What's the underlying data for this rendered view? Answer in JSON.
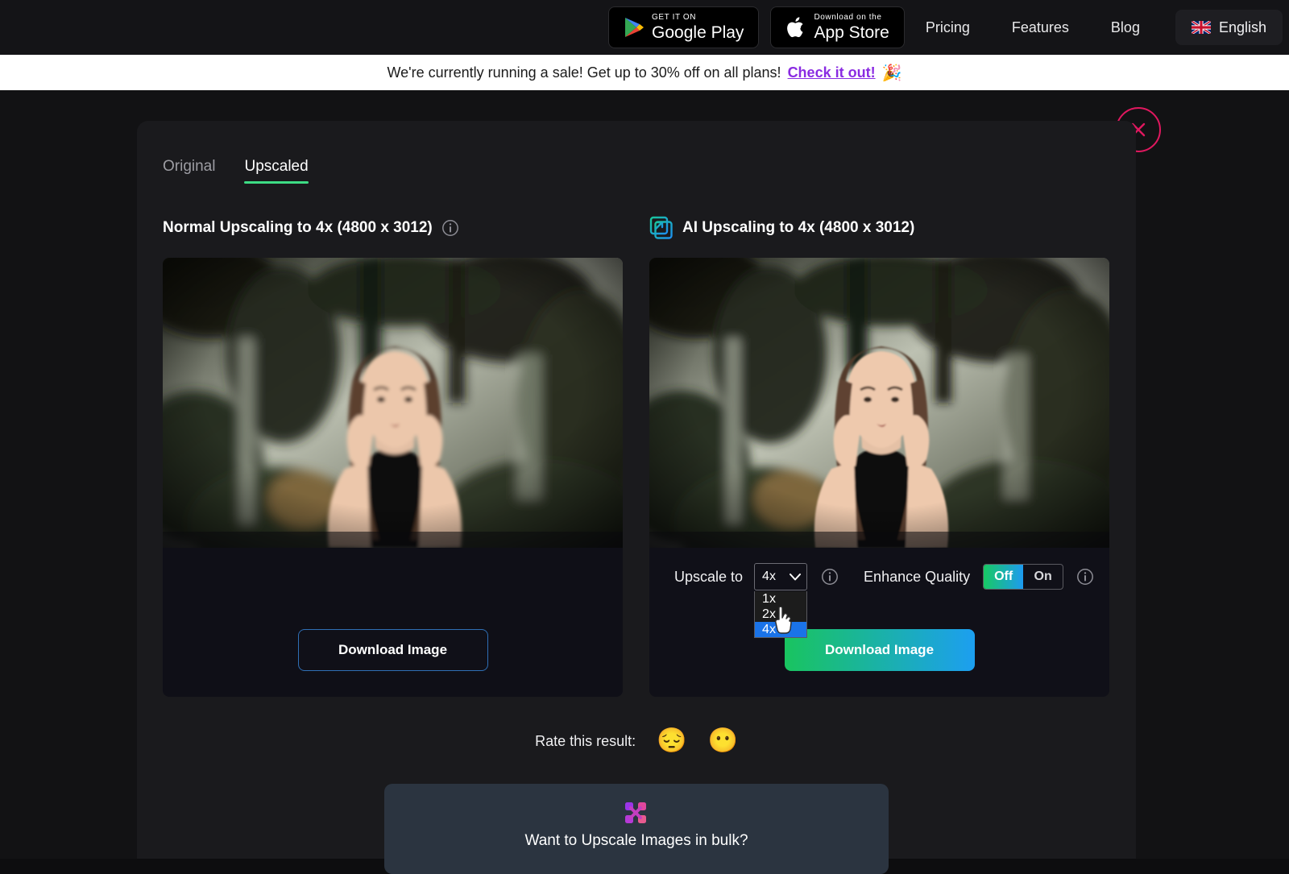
{
  "topnav": {
    "google_play": {
      "small": "GET IT ON",
      "big": "Google Play",
      "icon": "google-play-icon"
    },
    "app_store": {
      "small": "Download on the",
      "big": "App Store",
      "icon": "apple-icon"
    },
    "links": [
      {
        "label": "Pricing"
      },
      {
        "label": "Features"
      },
      {
        "label": "Blog"
      }
    ],
    "language": {
      "label": "English",
      "flag": "uk-flag-icon"
    }
  },
  "sale_banner": {
    "text": "We're currently running a sale! Get up to 30% off on all plans!",
    "link": "Check it out!",
    "emoji": "🎉",
    "link_color": "#8a2be2",
    "background": "#ffffff"
  },
  "modal": {
    "close_label": "close-modal",
    "close_color": "#e0185f",
    "tabs": [
      {
        "label": "Original",
        "active": false
      },
      {
        "label": "Upscaled",
        "active": true
      }
    ],
    "active_tab_color": "#3ddc84",
    "panels": {
      "normal": {
        "title": "Normal Upscaling to 4x (4800 x 3012)",
        "info_icon": "info-icon",
        "download_label": "Download Image"
      },
      "ai": {
        "title": "AI Upscaling to 4x (4800 x 3012)",
        "icon": "ai-upscale-icon",
        "info_icon": "info-icon",
        "download_label": "Download Image",
        "controls": {
          "upscale_label": "Upscale to",
          "upscale_value": "4x",
          "upscale_options": [
            "1x",
            "2x",
            "4x"
          ],
          "upscale_selected": "4x",
          "upscale_info_icon": "info-icon",
          "enhance_label": "Enhance Quality",
          "enhance_off": "Off",
          "enhance_on": "On",
          "enhance_state": "Off",
          "enhance_info_icon": "info-icon",
          "active_color": "#18c964"
        }
      }
    },
    "rate": {
      "label": "Rate this result:",
      "emojis": [
        "😔",
        "😶"
      ]
    },
    "bulk": {
      "text": "Want to Upscale Images in bulk?",
      "logo": "bulk-upscale-logo",
      "background": "#2b3440"
    }
  }
}
